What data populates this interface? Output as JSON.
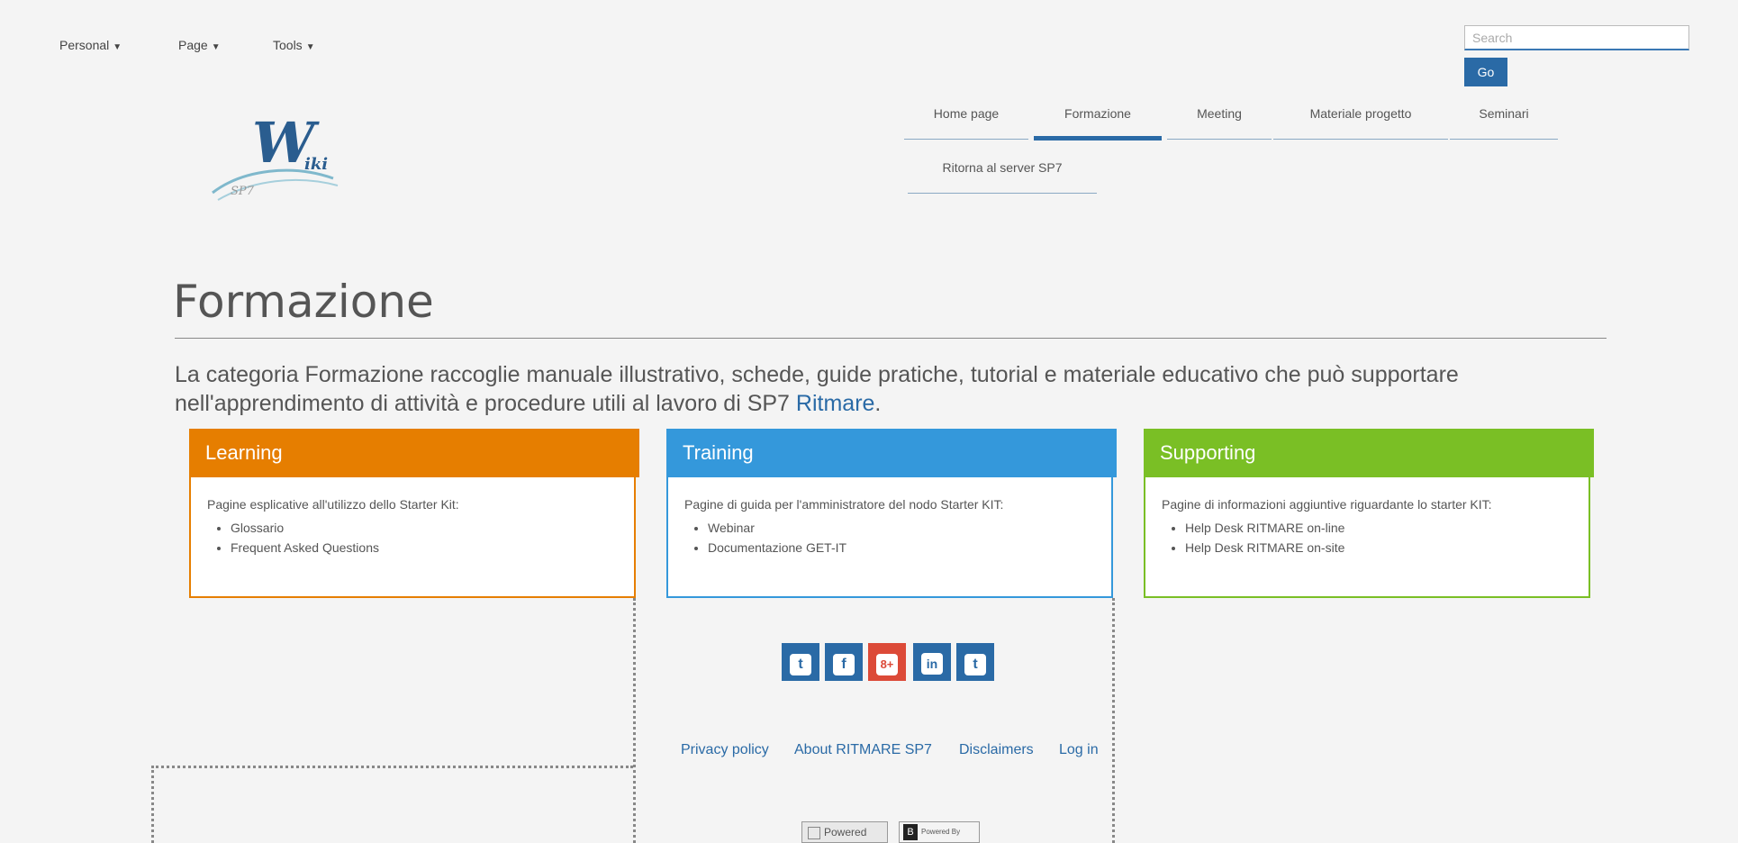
{
  "top_menu": {
    "personal": "Personal",
    "page": "Page",
    "tools": "Tools"
  },
  "search": {
    "placeholder": "Search",
    "go_label": "Go"
  },
  "logo": {
    "main_letter": "W",
    "suffix": "iki",
    "sub": "SP7"
  },
  "nav": {
    "items": [
      {
        "label": "Home page"
      },
      {
        "label": "Formazione"
      },
      {
        "label": "Meeting"
      },
      {
        "label": "Materiale progetto"
      },
      {
        "label": "Seminari"
      },
      {
        "label": "Ritorna al server SP7"
      }
    ]
  },
  "main": {
    "title": "Formazione",
    "intro_text": "La categoria Formazione raccoglie manuale illustrativo, schede, guide pratiche, tutorial e materiale educativo che può supportare nell'apprendimento di attività e procedure utili al lavoro di SP7 ",
    "intro_link": "Ritmare",
    "intro_end": "."
  },
  "cards": [
    {
      "title": "Learning",
      "color": "#e67e00",
      "desc": "Pagine esplicative all'utilizzo dello Starter Kit:",
      "links": [
        "Glossario",
        "Frequent Asked Questions"
      ]
    },
    {
      "title": "Training",
      "color": "#3498db",
      "desc": "Pagine di guida per l'amministratore del nodo Starter KIT:",
      "links": [
        "Webinar",
        "Documentazione GET-IT"
      ]
    },
    {
      "title": "Supporting",
      "color": "#7abf25",
      "desc": "Pagine di informazioni aggiuntive riguardante lo starter KIT:",
      "links": [
        "Help Desk RITMARE on-line",
        "Help Desk RITMARE on-site"
      ]
    }
  ],
  "social": [
    {
      "icon": "twitter-icon",
      "glyph": "t",
      "color": "#2a6aa6"
    },
    {
      "icon": "facebook-icon",
      "glyph": "f",
      "color": "#2a6aa6"
    },
    {
      "icon": "google-plus-icon",
      "glyph": "8+",
      "color": "#dc4a38"
    },
    {
      "icon": "linkedin-icon",
      "glyph": "in",
      "color": "#2a6aa6"
    },
    {
      "icon": "tumblr-icon",
      "glyph": "t",
      "color": "#2a6aa6"
    }
  ],
  "footer": {
    "privacy": "Privacy policy",
    "about": "About RITMARE SP7",
    "disclaimers": "Disclaimers",
    "login": "Log in",
    "powered_img_alt": "Powered",
    "powered_by": "Powered By"
  }
}
